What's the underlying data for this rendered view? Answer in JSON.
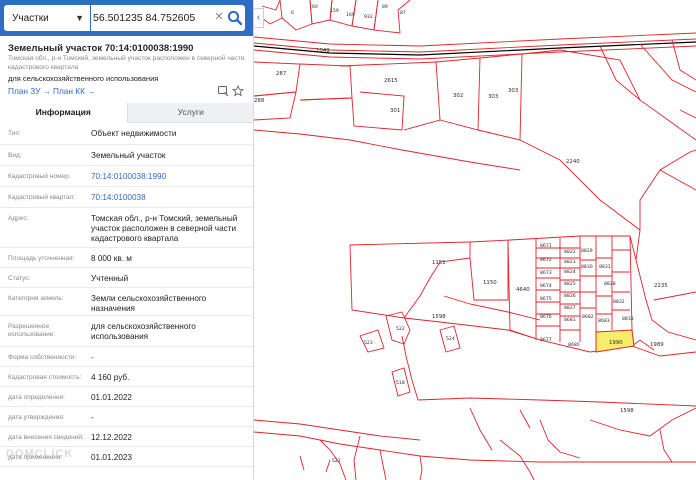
{
  "search": {
    "type_label": "Участки",
    "value": "56.501235 84.752605"
  },
  "object": {
    "title": "Земельный участок 70:14:0100038:1990",
    "address_line": "Томская обл., р-н Томский, земельный участок расположен в северной части кадастрового квартала",
    "purpose": "для сельскохозяйственного использования",
    "plan_zu": "План ЗУ →",
    "plan_kk": "План КК →"
  },
  "tabs": {
    "info": "Информация",
    "services": "Услуги"
  },
  "properties": [
    {
      "label": "Тип:",
      "value": "Объект недвижимости",
      "link": false
    },
    {
      "label": "Вид:",
      "value": "Земельный участок",
      "link": false
    },
    {
      "label": "Кадастровый номер:",
      "value": "70:14:0100038:1990",
      "link": true
    },
    {
      "label": "Кадастровый квартал:",
      "value": "70:14:0100038",
      "link": true
    },
    {
      "label": "Адрес:",
      "value": "Томская обл., р-н Томский, земельный участок расположен в северной части кадастрового квартала",
      "link": false
    },
    {
      "label": "Площадь уточненная:",
      "value": "8 000 кв. м",
      "link": false
    },
    {
      "label": "Статус:",
      "value": "Учтенный",
      "link": false
    },
    {
      "label": "Категория земель:",
      "value": "Земли сельскохозяйственного назначения",
      "link": false
    },
    {
      "label": "Разрешенное использование:",
      "value": "для сельскохозяйственного использования",
      "link": false
    },
    {
      "label": "Форма собственности:",
      "value": "-",
      "link": false
    },
    {
      "label": "Кадастровая стоимость:",
      "value": "4 160 руб.",
      "link": false
    },
    {
      "label": "дата определения:",
      "value": "01.01.2022",
      "link": false
    },
    {
      "label": "дата утверждения:",
      "value": "-",
      "link": false
    },
    {
      "label": "дата внесения сведений:",
      "value": "12.12.2022",
      "link": false
    },
    {
      "label": "дата применения:",
      "value": "01.01.2023",
      "link": false
    }
  ],
  "watermark": "DOMCLICK",
  "colors": {
    "accent": "#2f6dc2",
    "parcel_line": "#e0242b",
    "highlight": "#f6ee6a"
  },
  "icons": [
    "search-icon",
    "clear-icon",
    "chevron-down-icon",
    "collapse-icon",
    "print-icon",
    "star-icon"
  ],
  "map": {
    "selected": "1990",
    "labels": [
      "1049",
      "287",
      "2615",
      "301",
      "302",
      "303",
      "303",
      "288",
      "2240",
      "1151",
      "1150",
      "4640",
      "8671",
      "8672",
      "8673",
      "8674",
      "8675",
      "8822",
      "8823",
      "8824",
      "8825",
      "8826",
      "8827",
      "8828",
      "8829",
      "8830",
      "8831",
      "8832",
      "8833",
      "8676",
      "8677",
      "8680",
      "8681",
      "8682",
      "8683",
      "1598",
      "2235",
      "1989",
      "1990",
      "522",
      "523",
      "524",
      "518",
      "1598",
      "521",
      "159",
      "169",
      "932",
      "6",
      "60",
      "89",
      "87"
    ]
  }
}
